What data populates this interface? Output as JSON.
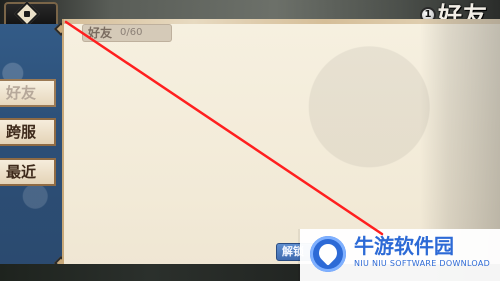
{
  "header": {
    "page_title": "好友",
    "coin_glyph": "1"
  },
  "sidebar": {
    "tabs": [
      {
        "label": "好友",
        "state": "selected"
      },
      {
        "label": "跨服"
      },
      {
        "label": "最近"
      }
    ]
  },
  "friend_panel": {
    "title": "好友",
    "count": "0/60"
  },
  "bottom": {
    "button_label": "解锁"
  },
  "watermark": {
    "title": "牛游软件园",
    "subtitle": "NIU NIU SOFTWARE DOWNLOAD"
  },
  "colors": {
    "panel_blue": "#335b87",
    "parchment": "#f6f0e0",
    "annotation_red": "#ff1f1f",
    "watermark_blue": "#2d6ad6"
  },
  "icons": [
    "back-arrow-icon",
    "coin-icon",
    "logo-icon"
  ]
}
